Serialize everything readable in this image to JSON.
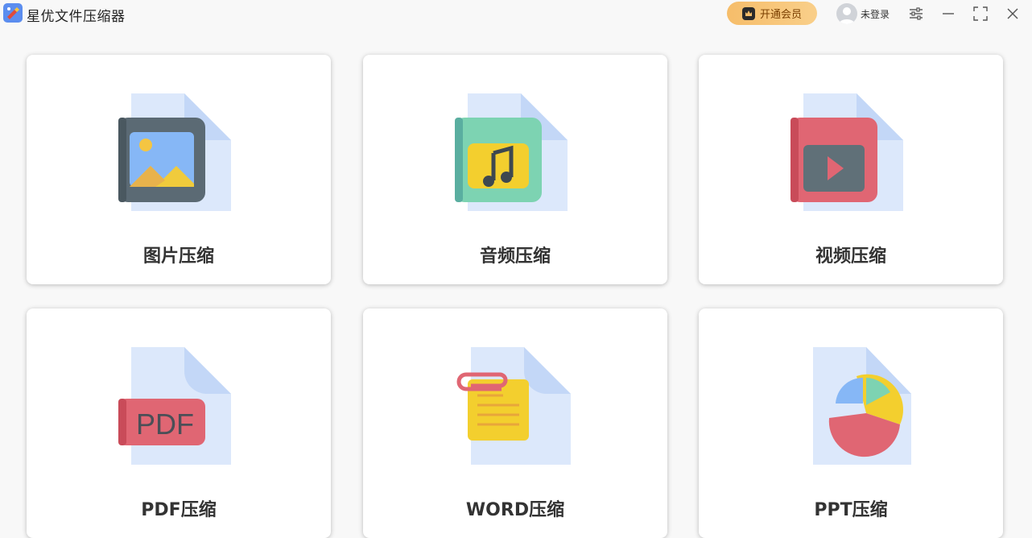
{
  "app": {
    "title": "星优文件压缩器"
  },
  "header": {
    "vip_label": "开通会员",
    "user_label": "未登录"
  },
  "icons": {
    "logo": "app-logo-icon",
    "vip": "crown-icon",
    "avatar": "user-avatar-icon",
    "settings": "sliders-icon",
    "minimize": "minimize-icon",
    "maximize": "maximize-icon",
    "close": "close-icon"
  },
  "colors": {
    "vip_gradient_start": "#f6bd6a",
    "vip_gradient_end": "#f9cf8a",
    "doc_back": "#dce8fb",
    "doc_fold": "#c3d7f7"
  },
  "tools": [
    {
      "label": "图片压缩",
      "icon": "image-file-icon"
    },
    {
      "label": "音频压缩",
      "icon": "audio-file-icon"
    },
    {
      "label": "视频压缩",
      "icon": "video-file-icon"
    },
    {
      "label": "PDF压缩",
      "icon": "pdf-file-icon"
    },
    {
      "label": "WORD压缩",
      "icon": "word-file-icon"
    },
    {
      "label": "PPT压缩",
      "icon": "ppt-file-icon"
    }
  ]
}
